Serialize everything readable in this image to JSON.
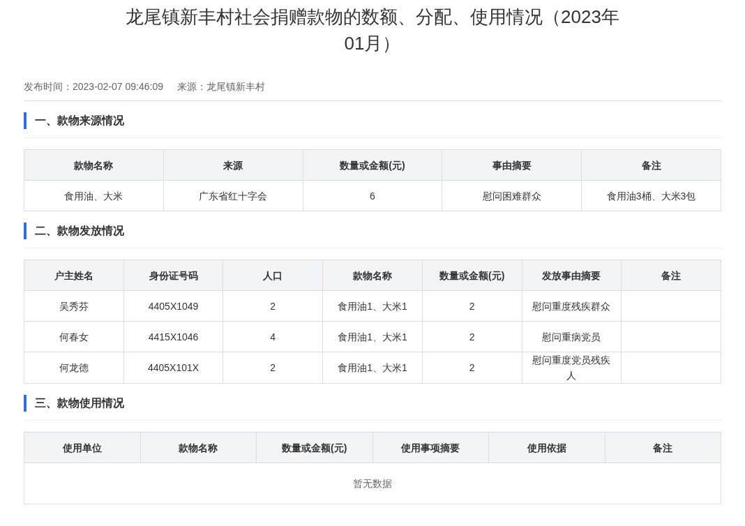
{
  "title": "龙尾镇新丰村社会捐赠款物的数额、分配、使用情况（2023年01月）",
  "meta": [
    {
      "label": "发布时间：",
      "value": "2023-02-07 09:46:09"
    },
    {
      "label": "来源：",
      "value": "龙尾镇新丰村"
    }
  ],
  "sections": [
    {
      "heading": "一、款物来源情况",
      "columns": [
        "款物名称",
        "来源",
        "数量或金额(元)",
        "事由摘要",
        "备注"
      ],
      "rows": [
        [
          "食用油、大米",
          "广东省红十字会",
          "6",
          "慰问困难群众",
          "食用油3桶、大米3包"
        ]
      ]
    },
    {
      "heading": "二、款物发放情况",
      "columns": [
        "户主姓名",
        "身份证号码",
        "人口",
        "款物名称",
        "数量或金额(元)",
        "发放事由摘要",
        "备注"
      ],
      "rows": [
        [
          "吴秀芬",
          "4405X1049",
          "2",
          "食用油1、大米1",
          "2",
          "慰问重度残疾群众",
          ""
        ],
        [
          "何春女",
          "4415X1046",
          "4",
          "食用油1、大米1",
          "2",
          "慰问重病党员",
          ""
        ],
        [
          "何龙德",
          "4405X101X",
          "2",
          "食用油1、大米1",
          "2",
          "慰问重度党员残疾人",
          ""
        ]
      ]
    },
    {
      "heading": "三、款物使用情况",
      "columns": [
        "使用单位",
        "款物名称",
        "数量或金额(元)",
        "使用事项摘要",
        "使用依据",
        "备注"
      ],
      "empty_text": "暂无数据"
    }
  ]
}
